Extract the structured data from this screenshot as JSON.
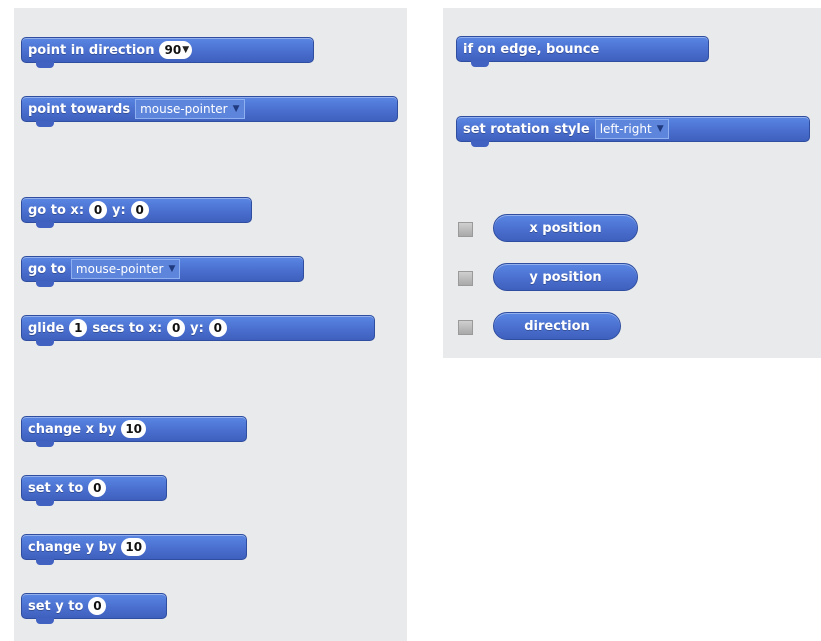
{
  "motion_blocks": {
    "point_in_direction": {
      "label": "point in direction",
      "value": "90"
    },
    "point_towards": {
      "label": "point towards",
      "dropdown": "mouse-pointer"
    },
    "go_to_xy": {
      "label": "go to x:",
      "x": "0",
      "y_label": "y:",
      "y": "0"
    },
    "go_to": {
      "label": "go to",
      "dropdown": "mouse-pointer"
    },
    "glide": {
      "label": "glide",
      "secs": "1",
      "secs_label": "secs to x:",
      "x": "0",
      "y_label": "y:",
      "y": "0"
    },
    "change_x": {
      "label": "change x by",
      "value": "10"
    },
    "set_x": {
      "label": "set x to",
      "value": "0"
    },
    "change_y": {
      "label": "change y by",
      "value": "10"
    },
    "set_y": {
      "label": "set y to",
      "value": "0"
    },
    "bounce": {
      "label": "if on edge, bounce"
    },
    "rotation_style": {
      "label": "set rotation style",
      "dropdown": "left-right"
    }
  },
  "reporters": [
    {
      "label": "x position",
      "checked": false
    },
    {
      "label": "y position",
      "checked": false
    },
    {
      "label": "direction",
      "checked": false
    }
  ],
  "colors": {
    "motion_block": "#4a6fcf",
    "palette_background": "#e9eaeb"
  }
}
